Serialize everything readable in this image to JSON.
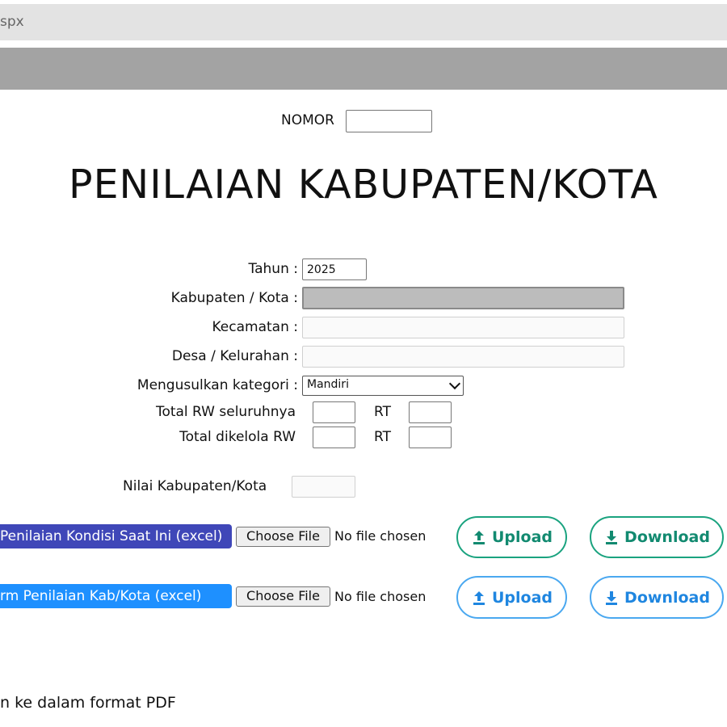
{
  "browser": {
    "url_fragment": "spx"
  },
  "header": {
    "nomor_label": "NOMOR",
    "nomor_value": ""
  },
  "page_title": "PENILAIAN KABUPATEN/KOTA",
  "form": {
    "tahun_label": "Tahun :",
    "tahun_value": "2025",
    "kabupaten_label": "Kabupaten / Kota :",
    "kabupaten_value": "",
    "kecamatan_label": "Kecamatan :",
    "kecamatan_value": "",
    "desa_label": "Desa / Kelurahan :",
    "desa_value": "",
    "kategori_label": "Mengusulkan kategori :",
    "kategori_selected": "Mandiri",
    "rw_total_label": "Total RW seluruhnya",
    "rw_total_value": "",
    "rt_label_1": "RT",
    "rt_total_value": "",
    "rw_kelola_label": "Total dikelola RW",
    "rw_kelola_value": "",
    "rt_label_2": "RT",
    "rt_kelola_value": "",
    "nilai_label": "Nilai Kabupaten/Kota",
    "nilai_value": ""
  },
  "uploads": [
    {
      "label": "Penilaian Kondisi Saat Ini (excel)",
      "choose_label": "Choose File",
      "file_status": "No file chosen",
      "upload_label": "Upload",
      "download_label": "Download",
      "color": "#3f47b8",
      "button_color": "#1aa37f"
    },
    {
      "label": "rm Penilaian Kab/Kota (excel)",
      "choose_label": "Choose File",
      "file_status": "No file chosen",
      "upload_label": "Upload",
      "download_label": "Download",
      "color": "#1e90ff",
      "button_color": "#4aa8f0"
    }
  ],
  "footer_text": "n ke dalam format PDF",
  "icons": {
    "upload": "upload-icon",
    "download": "download-icon",
    "dropdown": "chevron-down-icon"
  }
}
